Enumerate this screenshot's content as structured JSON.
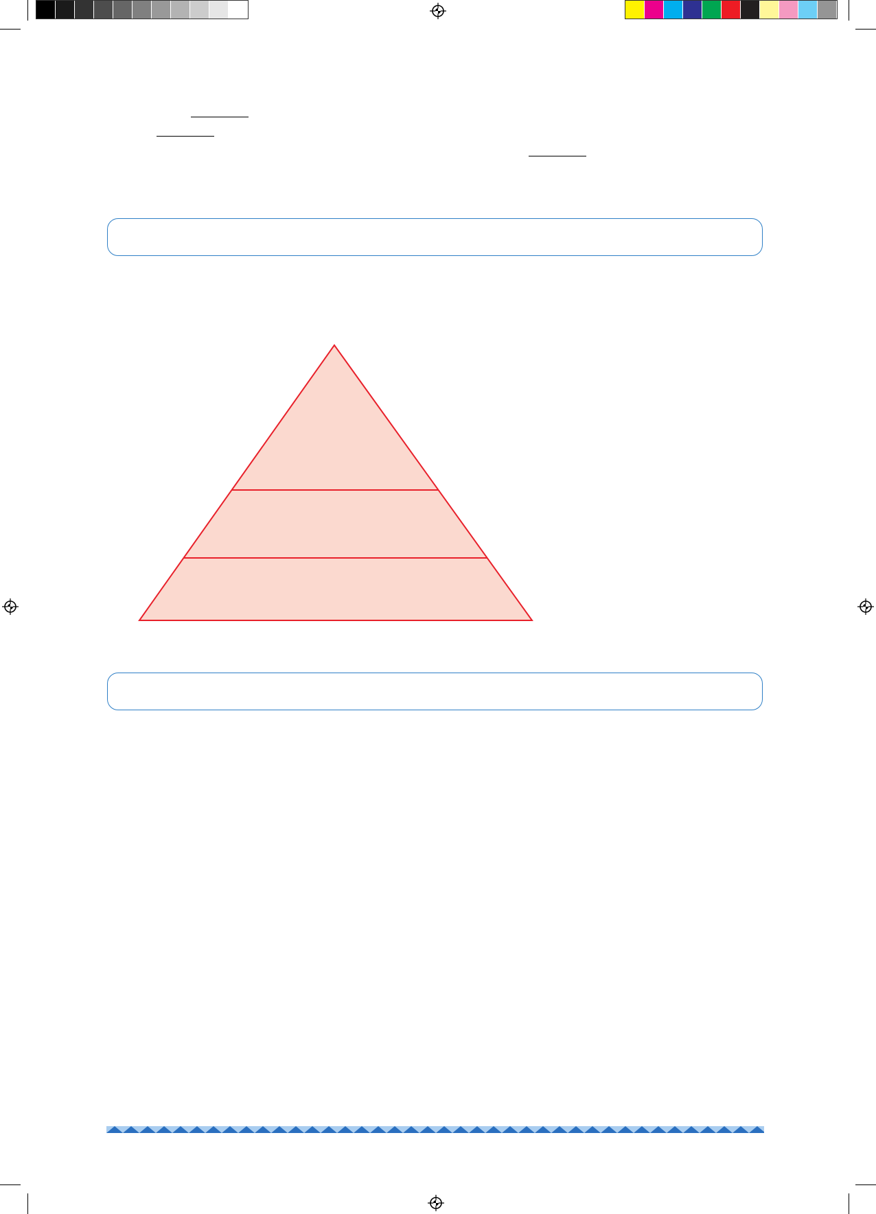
{
  "colors": {
    "box_border": "#2e7fc6",
    "pyramid_fill": "#fbd9cf",
    "pyramid_stroke": "#e8202a",
    "stripe_dark": "#2a6fbf",
    "stripe_light": "#a9cdf0"
  },
  "color_bars": {
    "grayscale": [
      "#000000",
      "#1a1a1a",
      "#333333",
      "#4d4d4d",
      "#666666",
      "#808080",
      "#999999",
      "#b3b3b3",
      "#cccccc",
      "#e6e6e6",
      "#ffffff"
    ],
    "process": [
      "#fff200",
      "#ec008c",
      "#00aeef",
      "#2e3192",
      "#00a651",
      "#ed1c24",
      "#231f20",
      "#fff799",
      "#f49ac1",
      "#6dcff6",
      "#959595"
    ]
  },
  "icons": {
    "registration_mark": "registration-target-icon"
  },
  "pyramid": {
    "levels": 3
  }
}
